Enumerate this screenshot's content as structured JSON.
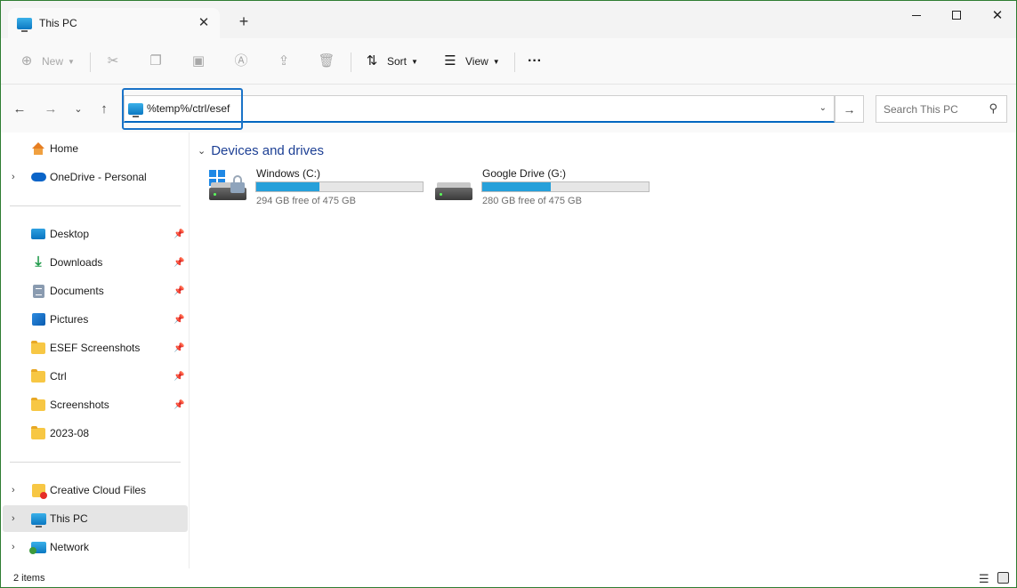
{
  "tab": {
    "title": "This PC",
    "icon": "this-pc-icon"
  },
  "toolbar": {
    "new_label": "New",
    "sort_label": "Sort",
    "view_label": "View",
    "more_label": "···"
  },
  "address": {
    "value": "%temp%/ctrl/esef"
  },
  "search": {
    "placeholder": "Search This PC"
  },
  "sidebar": {
    "items": [
      {
        "label": "Home",
        "icon": "home-icon"
      },
      {
        "label": "OneDrive - Personal",
        "icon": "onedrive-icon"
      },
      {
        "label": "Desktop",
        "icon": "desktop-icon",
        "pinned": true
      },
      {
        "label": "Downloads",
        "icon": "downloads-icon",
        "pinned": true
      },
      {
        "label": "Documents",
        "icon": "documents-icon",
        "pinned": true
      },
      {
        "label": "Pictures",
        "icon": "pictures-icon",
        "pinned": true
      },
      {
        "label": "ESEF Screenshots",
        "icon": "folder-icon",
        "pinned": true
      },
      {
        "label": "Ctrl",
        "icon": "folder-icon",
        "pinned": true
      },
      {
        "label": "Screenshots",
        "icon": "folder-icon",
        "pinned": true
      },
      {
        "label": "2023-08",
        "icon": "folder-icon",
        "pinned": false
      },
      {
        "label": "Creative Cloud Files",
        "icon": "creative-cloud-icon"
      },
      {
        "label": "This PC",
        "icon": "this-pc-icon",
        "selected": true
      },
      {
        "label": "Network",
        "icon": "network-icon"
      }
    ]
  },
  "main": {
    "group_title": "Devices and drives",
    "drives": [
      {
        "name": "Windows (C:)",
        "free_text": "294 GB free of 475 GB",
        "used_fraction": 0.381
      },
      {
        "name": "Google Drive (G:)",
        "free_text": "280 GB free of 475 GB",
        "used_fraction": 0.411
      }
    ]
  },
  "status": {
    "items_text": "2 items"
  },
  "colors": {
    "accent": "#0067c0",
    "bar_fill": "#26a0da",
    "focus_ring": "#1a73c8"
  }
}
